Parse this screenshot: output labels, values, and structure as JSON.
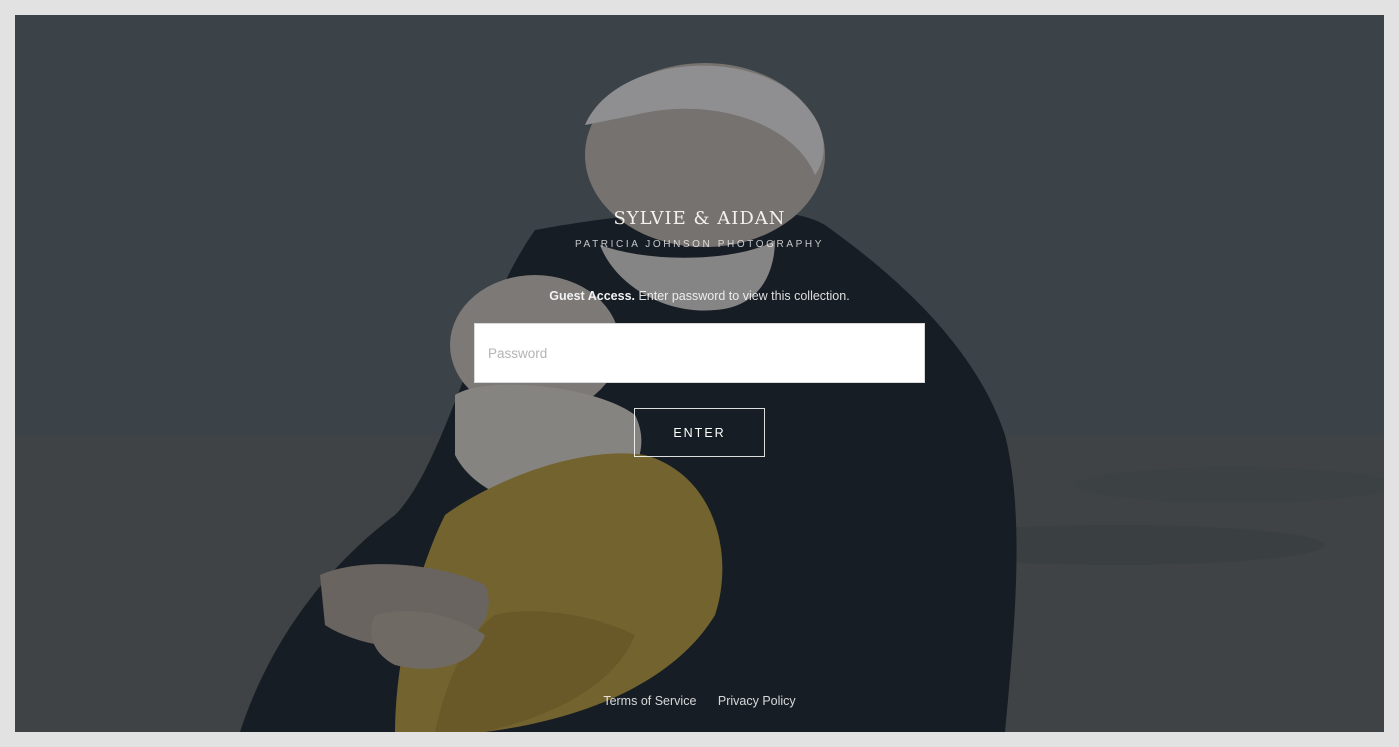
{
  "gallery": {
    "title": "SYLVIE & AIDAN",
    "subtitle": "PATRICIA JOHNSON PHOTOGRAPHY"
  },
  "access": {
    "label": "Guest Access.",
    "message": " Enter password to view this collection."
  },
  "form": {
    "password_placeholder": "Password",
    "enter_label": "ENTER"
  },
  "footer": {
    "links": [
      "Terms of Service",
      "Privacy Policy"
    ]
  },
  "colors": {
    "frame_border": "#e2e2e2",
    "overlay": "#12181e"
  }
}
